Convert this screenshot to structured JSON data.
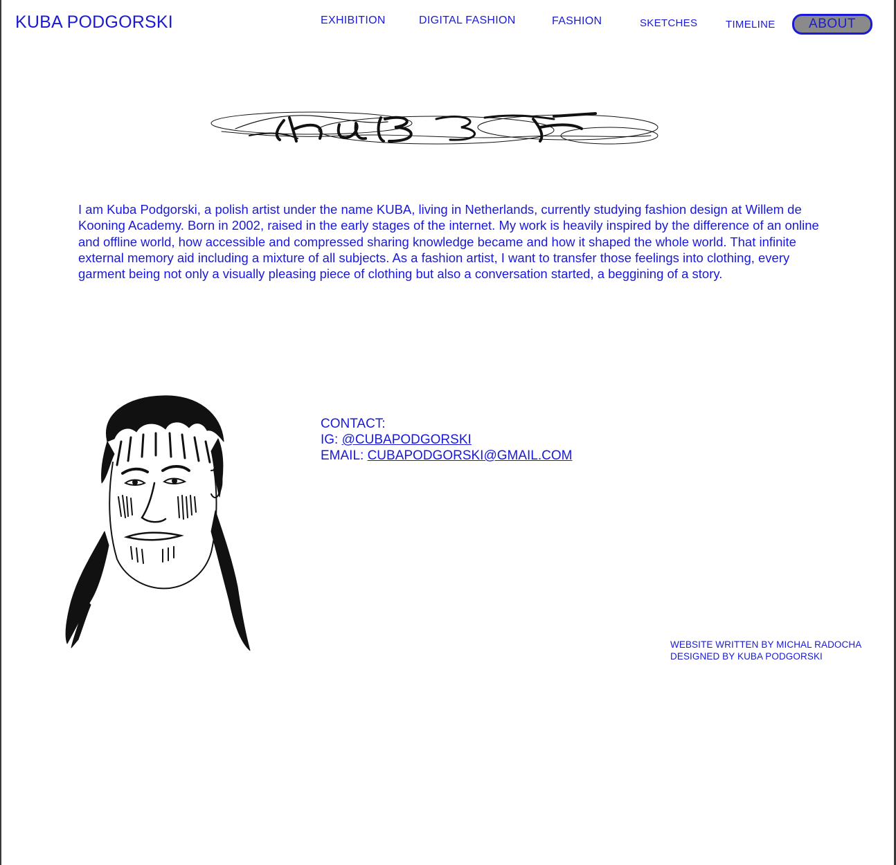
{
  "header": {
    "brand": "KUBA PODGORSKI",
    "nav": {
      "exhibition": "EXHIBITION",
      "digital_fashion": "DIGITAL FASHION",
      "fashion": "FASHION",
      "sketches": "SKETCHES",
      "timeline": "TIMELINE",
      "about": "ABOUT"
    }
  },
  "signature_logo": {
    "text": "KUBA",
    "icon": "calligraphic-signature-logo"
  },
  "bio": {
    "text": "I am Kuba Podgorski, a polish artist  under the name KUBA, living in Netherlands,  currently studying fashion design at Willem de Kooning Academy. Born in 2002, raised in the early stages of the internet. My work is heavily inspired by the difference of an online and offline world, how accessible and compressed sharing knowledge became and how it shaped the whole world. That infinite external memory aid including a mixture of all subjects. As a fashion artist, I want to transfer those feelings into clothing, every garment being not only a visually pleasing piece of clothing but also a conversation started, a beggining of a story."
  },
  "portrait": {
    "icon": "ink-portrait-drawing"
  },
  "contact": {
    "heading": "CONTACT:",
    "ig_label": "IG: ",
    "ig_handle": "@CUBAPODGORSKI",
    "email_label": "EMAIL: ",
    "email": "CUBAPODGORSKI@GMAIL.COM"
  },
  "credits": {
    "line1": "WEBSITE WRITTEN BY MICHAL RADOCHA",
    "line2": "DESIGNED BY KUBA PODGORSKI"
  },
  "colors": {
    "accent": "#1a1ad6",
    "about_fill": "#8a8a8a",
    "frame": "#3a3a3a"
  }
}
